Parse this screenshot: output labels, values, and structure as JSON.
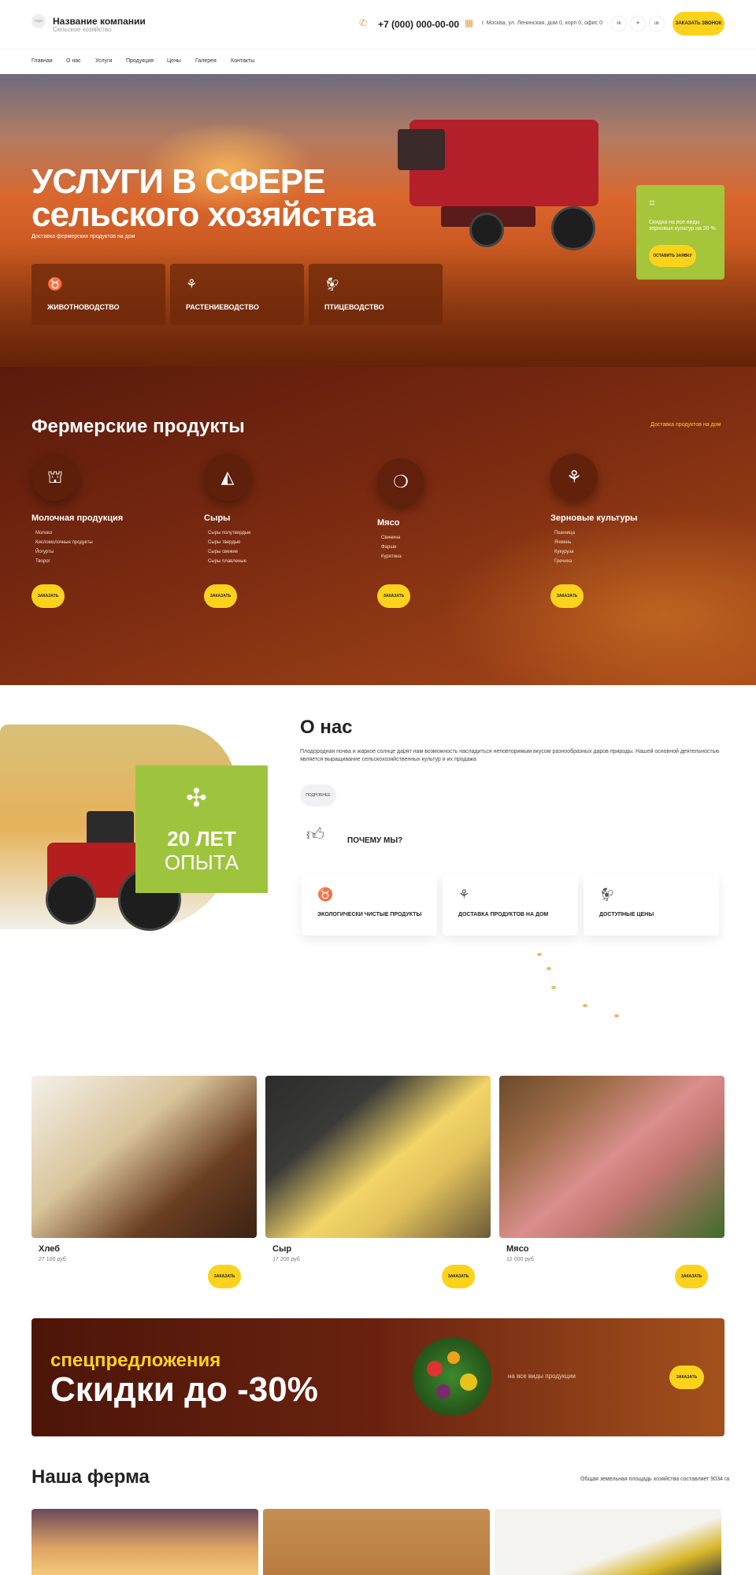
{
  "header": {
    "logo_text": "logo",
    "company_name": "Название компании",
    "company_subtitle": "Сельское хозяйство",
    "phone": "+7 (000) 000-00-00",
    "address": "г. Москва, ул. Ленинская, дом 0, корп 0, офис 0",
    "socials": [
      "vk-icon",
      "telegram-icon",
      "odnoklassniki-icon"
    ],
    "social_glyphs": [
      "vk",
      "✈",
      "ok"
    ],
    "call_button": "ЗАКАЗАТЬ ЗВОНОК"
  },
  "nav": [
    "Главная",
    "О нас",
    "Услуги",
    "Продукция",
    "Цены",
    "Галерея",
    "Контакты"
  ],
  "hero": {
    "title_line1": "УСЛУГИ В СФЕРЕ",
    "title_line2": "сельского хозяйства",
    "subtitle": "Доставка фермерских продуктов на дом",
    "services": [
      {
        "label": "ЖИВОТНОВОДСТВО",
        "icon": "cow-icon"
      },
      {
        "label": "РАСТЕНИЕВОДСТВО",
        "icon": "wheat-icon"
      },
      {
        "label": "ПТИЦЕВОДСТВО",
        "icon": "chicken-icon"
      }
    ],
    "discount_text": "Скидка на все виды зерновых культур на 20 %",
    "discount_button": "ОСТАВИТЬ ЗАЯВКУ"
  },
  "products": {
    "title": "Фермерские продукты",
    "right_link": "Доставка продуктов на дом",
    "order_button": "ЗАКАЗАТЬ",
    "columns": [
      {
        "title": "Молочная продукция",
        "icon": "milk-bottles-icon",
        "items": [
          "Молоко",
          "Кисломолочные продукты",
          "Йогурты",
          "Творог"
        ]
      },
      {
        "title": "Сыры",
        "icon": "cheese-icon",
        "items": [
          "Сыры полутвердые",
          "Сыры твердые",
          "Сыры свежие",
          "Сыры плавленые"
        ]
      },
      {
        "title": "Мясо",
        "icon": "meat-icon",
        "items": [
          "Свинина",
          "Фарши",
          "Курятина"
        ]
      },
      {
        "title": "Зерновые культуры",
        "icon": "grain-icon",
        "items": [
          "Пшеница",
          "Ячмень",
          "Кукуруза",
          "Гречиха"
        ]
      }
    ]
  },
  "about": {
    "experience_a": "20 ЛЕТ",
    "experience_b": "ОПЫТА",
    "title": "О нас",
    "text": "Плодородная почва и жаркое солнце дарят нам возможность насладиться неповторимым вкусом разнообразных даров природы. Нашей основной деятельностью является выращивание сельскохозяйственных культур и их продажа",
    "more_button": "ПОДРОБНЕЕ",
    "why_title": "ПОЧЕМУ МЫ?",
    "features": [
      {
        "label": "ЭКОЛОГИЧЕСКИ ЧИСТЫЕ ПРОДУКТЫ",
        "icon": "cow-icon"
      },
      {
        "label": "ДОСТАВКА ПРОДУКТОВ НА ДОМ",
        "icon": "wheat-icon"
      },
      {
        "label": "ДОСТУПНЫЕ ЦЕНЫ",
        "icon": "chicken-icon"
      }
    ]
  },
  "goods": {
    "order_button": "ЗАКАЗАТЬ",
    "items": [
      {
        "name": "Хлеб",
        "price": "27 100 руб"
      },
      {
        "name": "Сыр",
        "price": "17 200 руб"
      },
      {
        "name": "Мясо",
        "price": "12 000 руб"
      }
    ]
  },
  "promo": {
    "subtitle": "спецпредложения",
    "title": "Скидки до -30%",
    "text": "на все виды продукции",
    "button": "ЗАКАЗАТЬ"
  },
  "farm": {
    "title": "Наша ферма",
    "right_text": "Общая земельная площадь хозяйства составляет 9034 га"
  },
  "colors": {
    "accent_yellow": "#fcd21b",
    "green": "#9ec43d",
    "brown_dark": "#5a1a0c",
    "orange_icon": "#e9a04c"
  }
}
